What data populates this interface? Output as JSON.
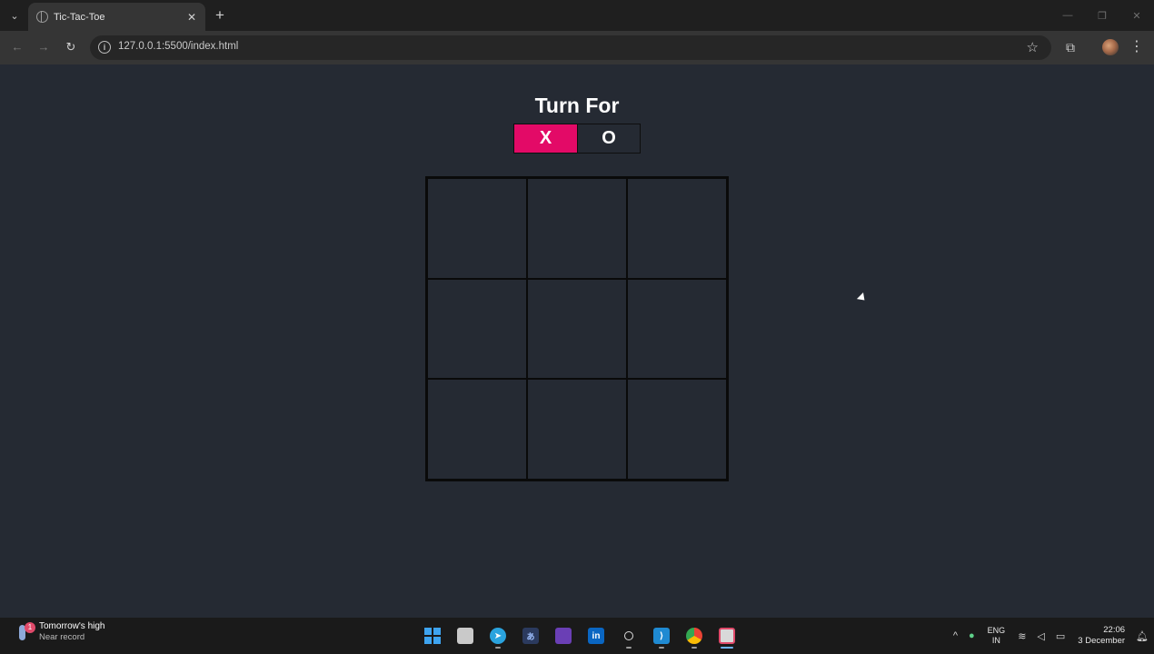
{
  "browser": {
    "tab_title": "Tic-Tac-Toe",
    "url": "127.0.0.1:5500/index.html",
    "icons": {
      "tab_search": "chevron-down-icon",
      "tab_close": "close-icon",
      "new_tab": "plus-icon",
      "back": "back-arrow-icon",
      "forward": "forward-arrow-icon",
      "reload": "reload-icon",
      "site_info": "info-icon",
      "bookmark": "star-icon",
      "extensions": "puzzle-icon",
      "menu": "kebab-menu-icon"
    }
  },
  "game": {
    "heading": "Turn For",
    "turn_options": [
      "X",
      "O"
    ],
    "active_turn": "X",
    "board": [
      "",
      "",
      "",
      "",
      "",
      "",
      "",
      "",
      ""
    ],
    "colors": {
      "background": "#252a33",
      "active_turn": "#e30a67",
      "grid_line": "#0a0a0a"
    }
  },
  "taskbar": {
    "weather_title": "Tomorrow's high",
    "weather_sub": "Near record",
    "weather_badge": "1",
    "apps": [
      "windows-start",
      "file-explorer",
      "telegram",
      "notepad",
      "media-app",
      "linkedin",
      "obs",
      "vs-code",
      "chrome",
      "snipping-tool"
    ],
    "lang_top": "ENG",
    "lang_bottom": "IN",
    "time": "22:06",
    "date": "3 December"
  }
}
